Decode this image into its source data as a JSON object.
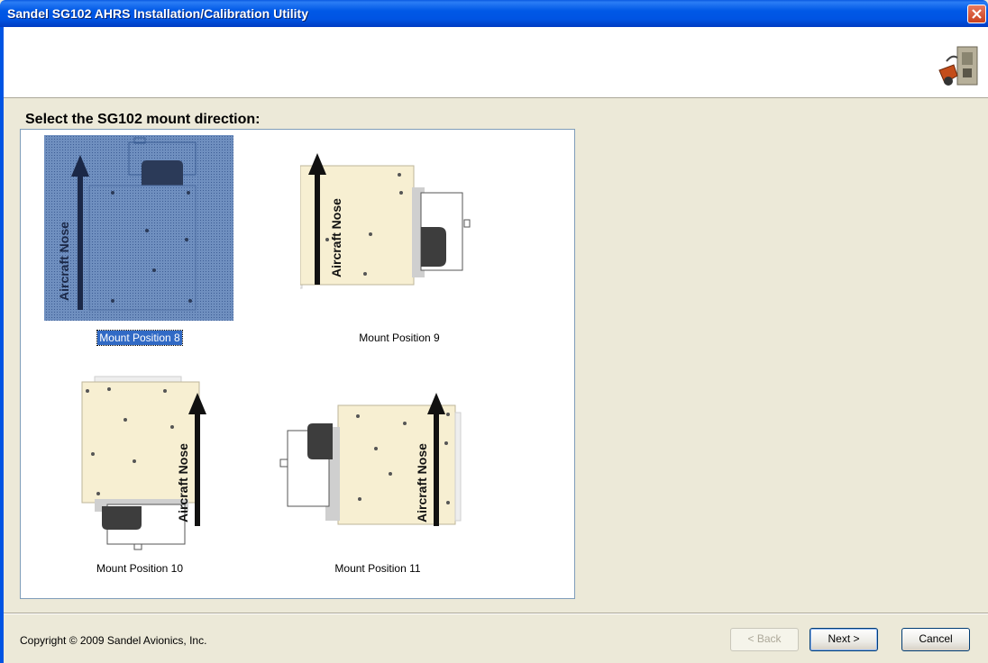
{
  "window": {
    "title": "Sandel SG102 AHRS Installation/Calibration Utility"
  },
  "prompt": "Select the SG102 mount direction:",
  "mount_positions": [
    {
      "label": "Mount Position 8",
      "arrow_label": "Aircraft Nose",
      "selected": true
    },
    {
      "label": "Mount Position 9",
      "arrow_label": "Aircraft Nose",
      "selected": false
    },
    {
      "label": "Mount Position 10",
      "arrow_label": "Aircraft Nose",
      "selected": false
    },
    {
      "label": "Mount Position 11",
      "arrow_label": "Aircraft Nose",
      "selected": false
    }
  ],
  "footer": {
    "copyright": "Copyright © 2009 Sandel Avionics, Inc.",
    "back_label": "< Back",
    "next_label": "Next >",
    "cancel_label": "Cancel"
  },
  "colors": {
    "title_bar": "#0054e3",
    "dialog_bg": "#ece9d8",
    "unit_body": "#f7efd2",
    "selection": "#316ac5"
  },
  "icons": {
    "close": "close-icon",
    "app": "ahrs-device-icon"
  }
}
